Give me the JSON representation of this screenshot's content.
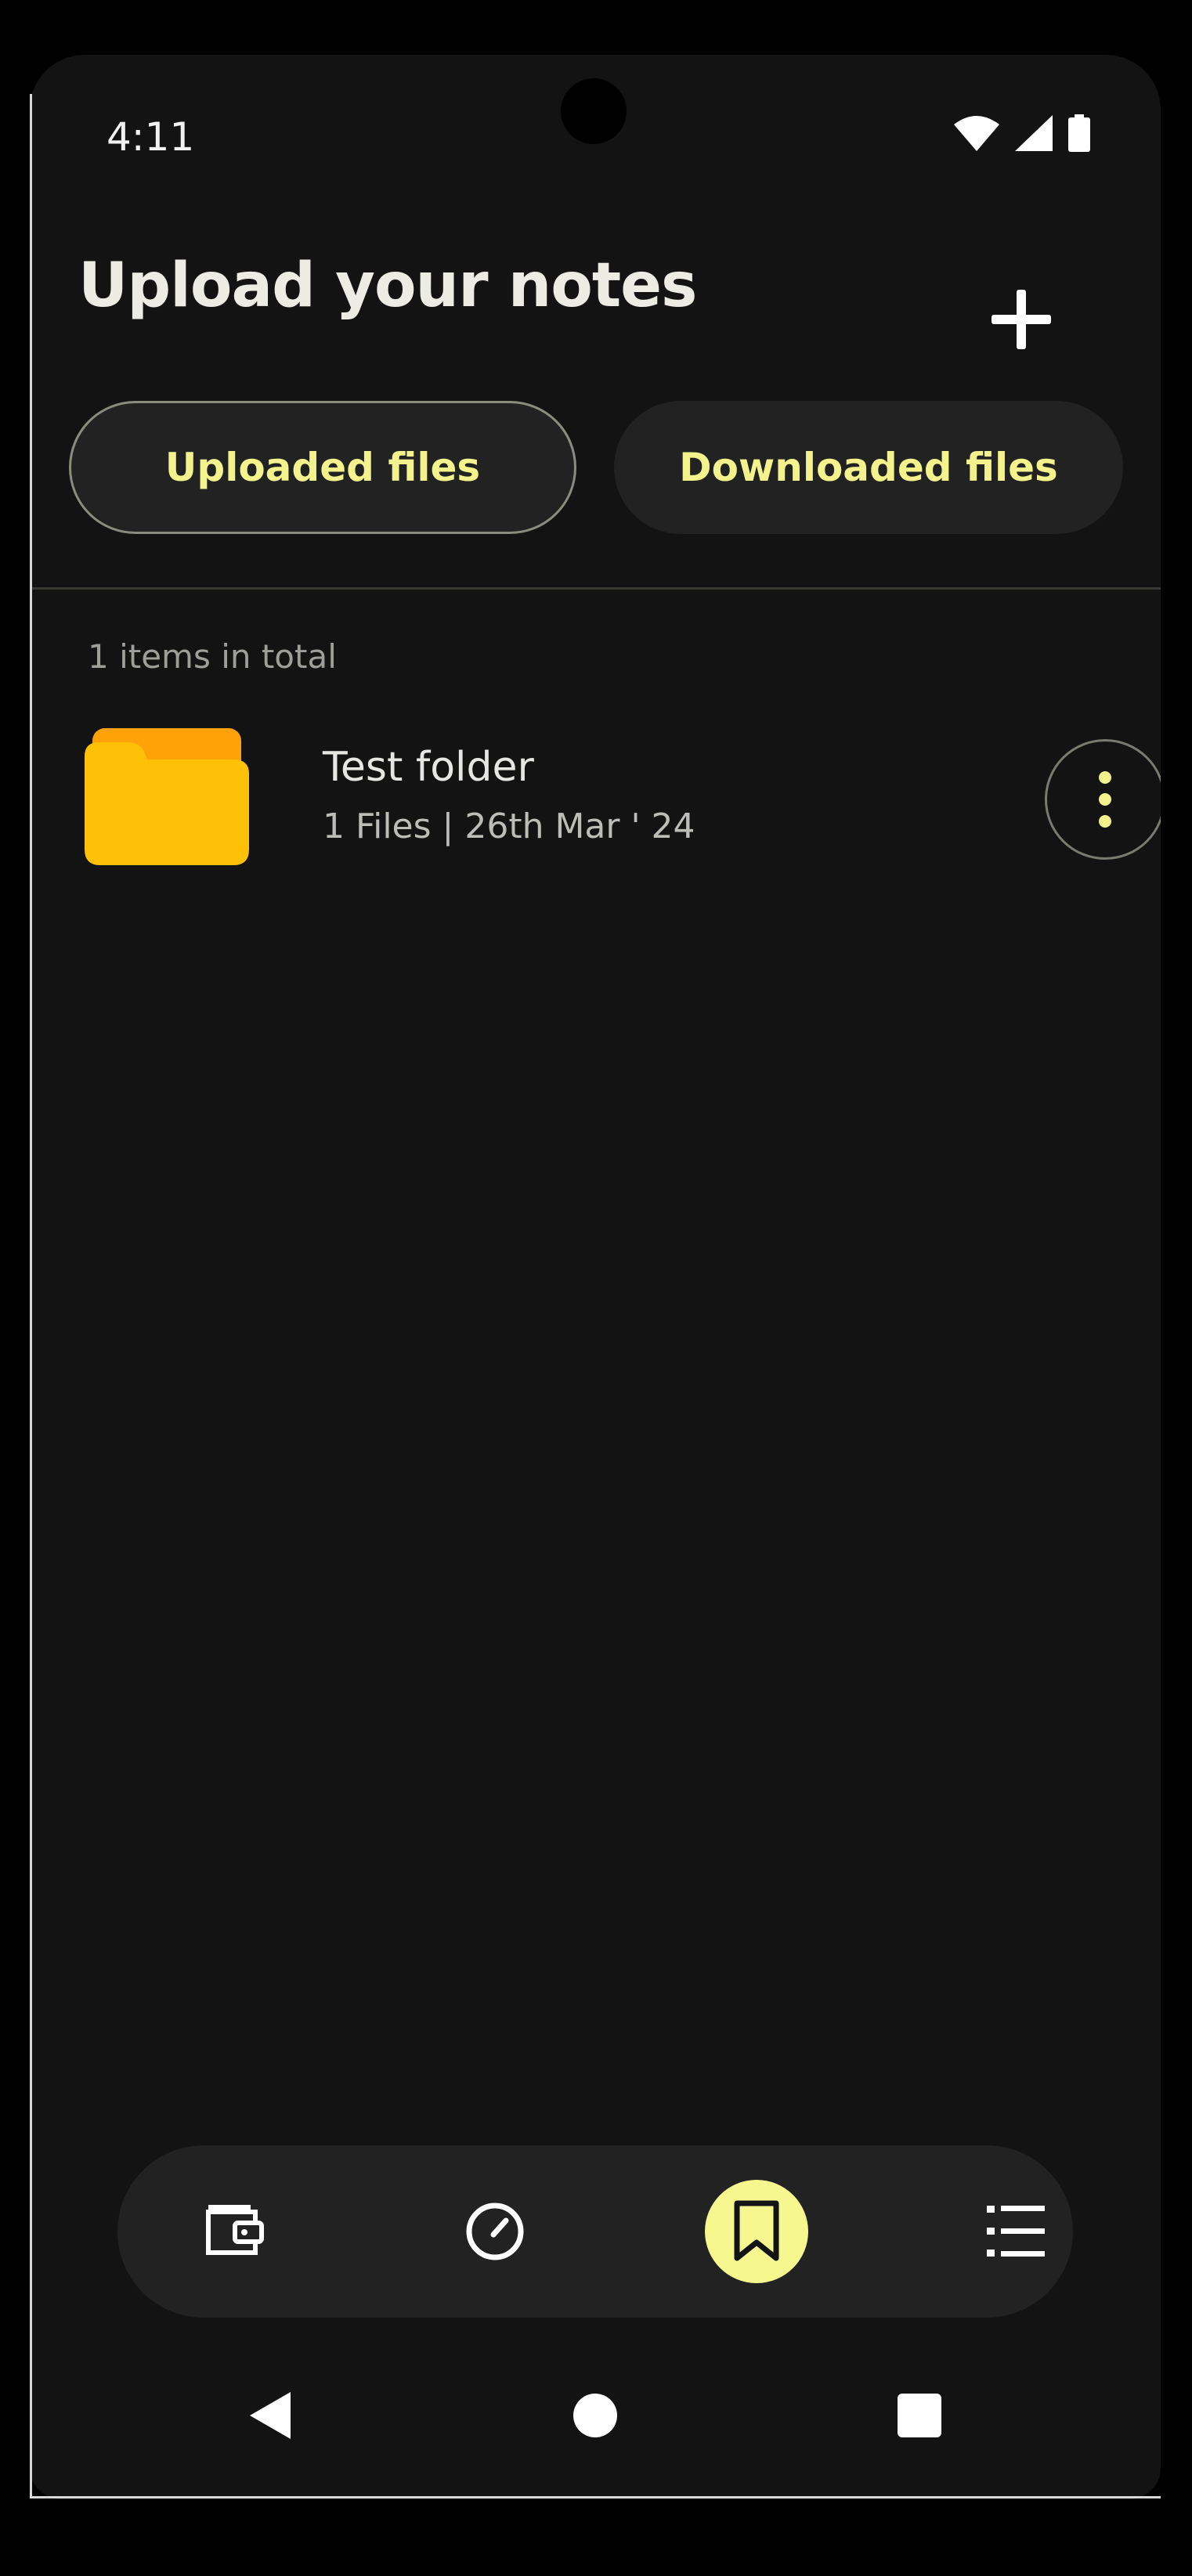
{
  "status_bar": {
    "time": "4:11",
    "icons": [
      "wifi-icon",
      "cellular-signal-icon",
      "battery-icon"
    ]
  },
  "header": {
    "title": "Upload your notes",
    "add_icon": "plus-icon"
  },
  "tabs": [
    {
      "label": "Uploaded files",
      "selected": true
    },
    {
      "label": "Downloaded files",
      "selected": false
    }
  ],
  "list": {
    "count_label": "1 items in total",
    "items": [
      {
        "name": "Test folder",
        "meta": "1 Files | 26th Mar ' 24",
        "icon": "folder-icon",
        "menu_icon": "more-vert-icon"
      }
    ]
  },
  "bottom_nav": {
    "items": [
      {
        "icon": "wallet-icon",
        "active": false
      },
      {
        "icon": "gauge-icon",
        "active": false
      },
      {
        "icon": "bookmark-icon",
        "active": true
      },
      {
        "icon": "list-icon",
        "active": false
      }
    ]
  },
  "system_nav": [
    "back-icon",
    "home-icon",
    "recents-icon"
  ],
  "colors": {
    "background": "#131313",
    "accent": "#f6f78f",
    "tab_text": "#f3f28c",
    "surface": "#222222",
    "folder": "#ffc107"
  }
}
